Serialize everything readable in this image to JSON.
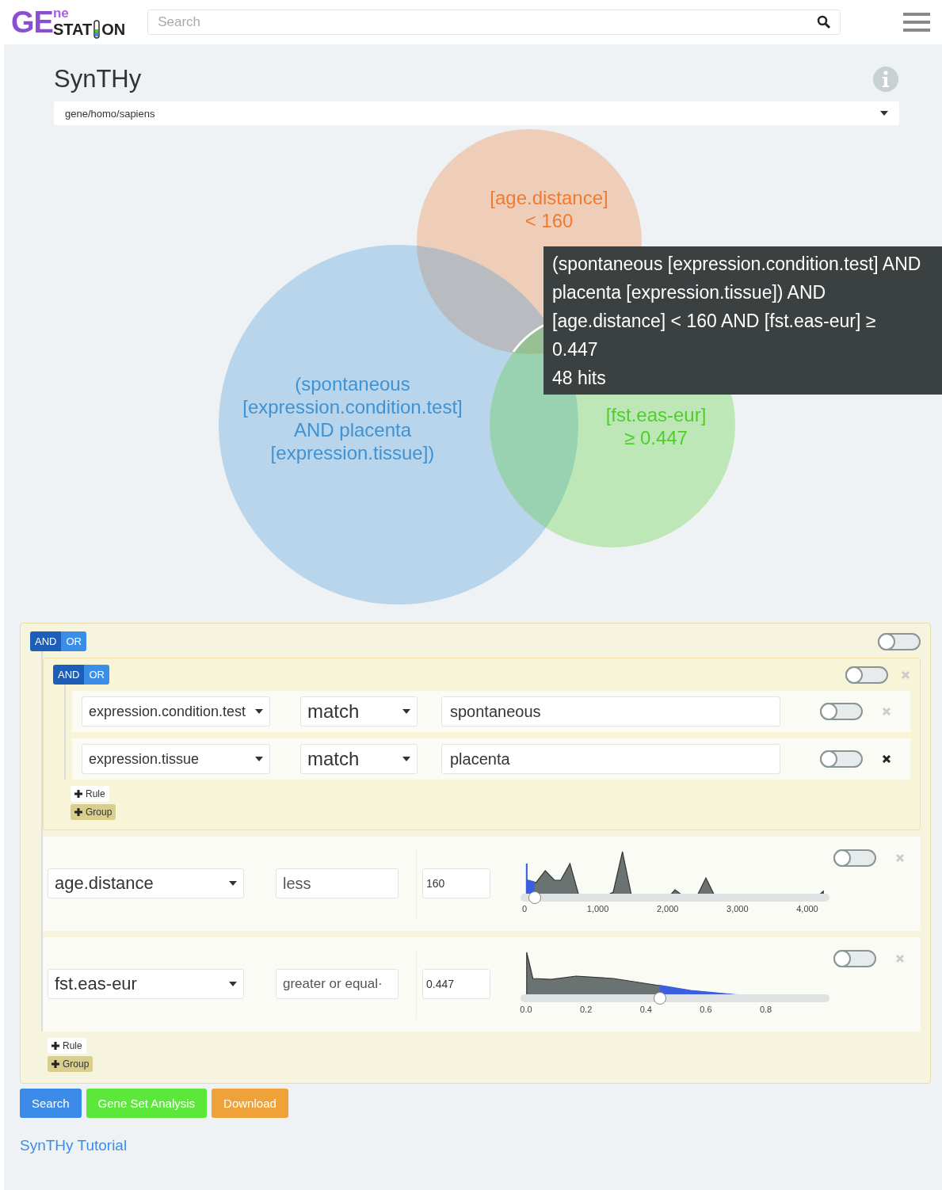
{
  "header": {
    "logo": {
      "big": "GE",
      "top": "ne",
      "bottom_left": "STAT",
      "bottom_right": "ON"
    },
    "search": {
      "placeholder": "Search"
    }
  },
  "page": {
    "title": "SynTHy",
    "dataset_select": "gene/homo/sapiens"
  },
  "venn": {
    "sets": [
      {
        "lines": [
          "[age.distance]",
          "< 160"
        ],
        "color": "#f07a30"
      },
      {
        "lines": [
          "(spontaneous",
          "[expression.condition.test]",
          "AND placenta",
          "[expression.tissue])"
        ],
        "color": "#3d93d6"
      },
      {
        "lines": [
          "[fst.eas-eur]",
          "≥ 0.447"
        ],
        "color": "#4fce2a"
      }
    ],
    "tooltip": {
      "text": "(spontaneous [expression.condition.test] AND placenta [expression.tissue]) AND [age.distance] < 160 AND [fst.eas-eur] ≥ 0.447",
      "hits": "48 hits"
    }
  },
  "query": {
    "conjunctions": [
      {
        "label": "AND",
        "selected": true
      },
      {
        "label": "OR",
        "selected": false
      }
    ],
    "on": false,
    "children": [
      {
        "kind": "group",
        "conjunctions": [
          {
            "label": "AND",
            "selected": true
          },
          {
            "label": "OR",
            "selected": false
          }
        ],
        "on": false,
        "deletable": false,
        "children": [
          {
            "kind": "text_rule",
            "field": "expression.condition.test",
            "operator": "match",
            "value": "spontaneous",
            "on": false,
            "deletable": false
          },
          {
            "kind": "text_rule",
            "field": "expression.tissue",
            "operator": "match",
            "value": "placenta",
            "on": false,
            "deletable": true
          }
        ],
        "add_rule": "Rule",
        "add_group": "Group"
      },
      {
        "kind": "range_rule",
        "field": "age.distance",
        "operator": "less",
        "value": "160",
        "ticks": [
          "0",
          "1,000",
          "2,000",
          "3,000",
          "4,000"
        ],
        "level": 0.045,
        "on": false,
        "deletable": false
      },
      {
        "kind": "range_rule",
        "field": "fst.eas-eur",
        "operator": "greater or equal·",
        "value": "0.447",
        "ticks": [
          "0.0",
          "0.2",
          "0.4",
          "0.6",
          "0.8"
        ],
        "level": 0.45,
        "on": false,
        "deletable": false
      }
    ],
    "add_rule": "Rule",
    "add_group": "Group"
  },
  "actions": [
    {
      "label": "Search",
      "color": "#3d8be8"
    },
    {
      "label": "Gene Set Analysis",
      "color": "#5ce83a"
    },
    {
      "label": "Download",
      "color": "#f0a23a"
    }
  ],
  "tutorial_link": "SynTHy Tutorial"
}
